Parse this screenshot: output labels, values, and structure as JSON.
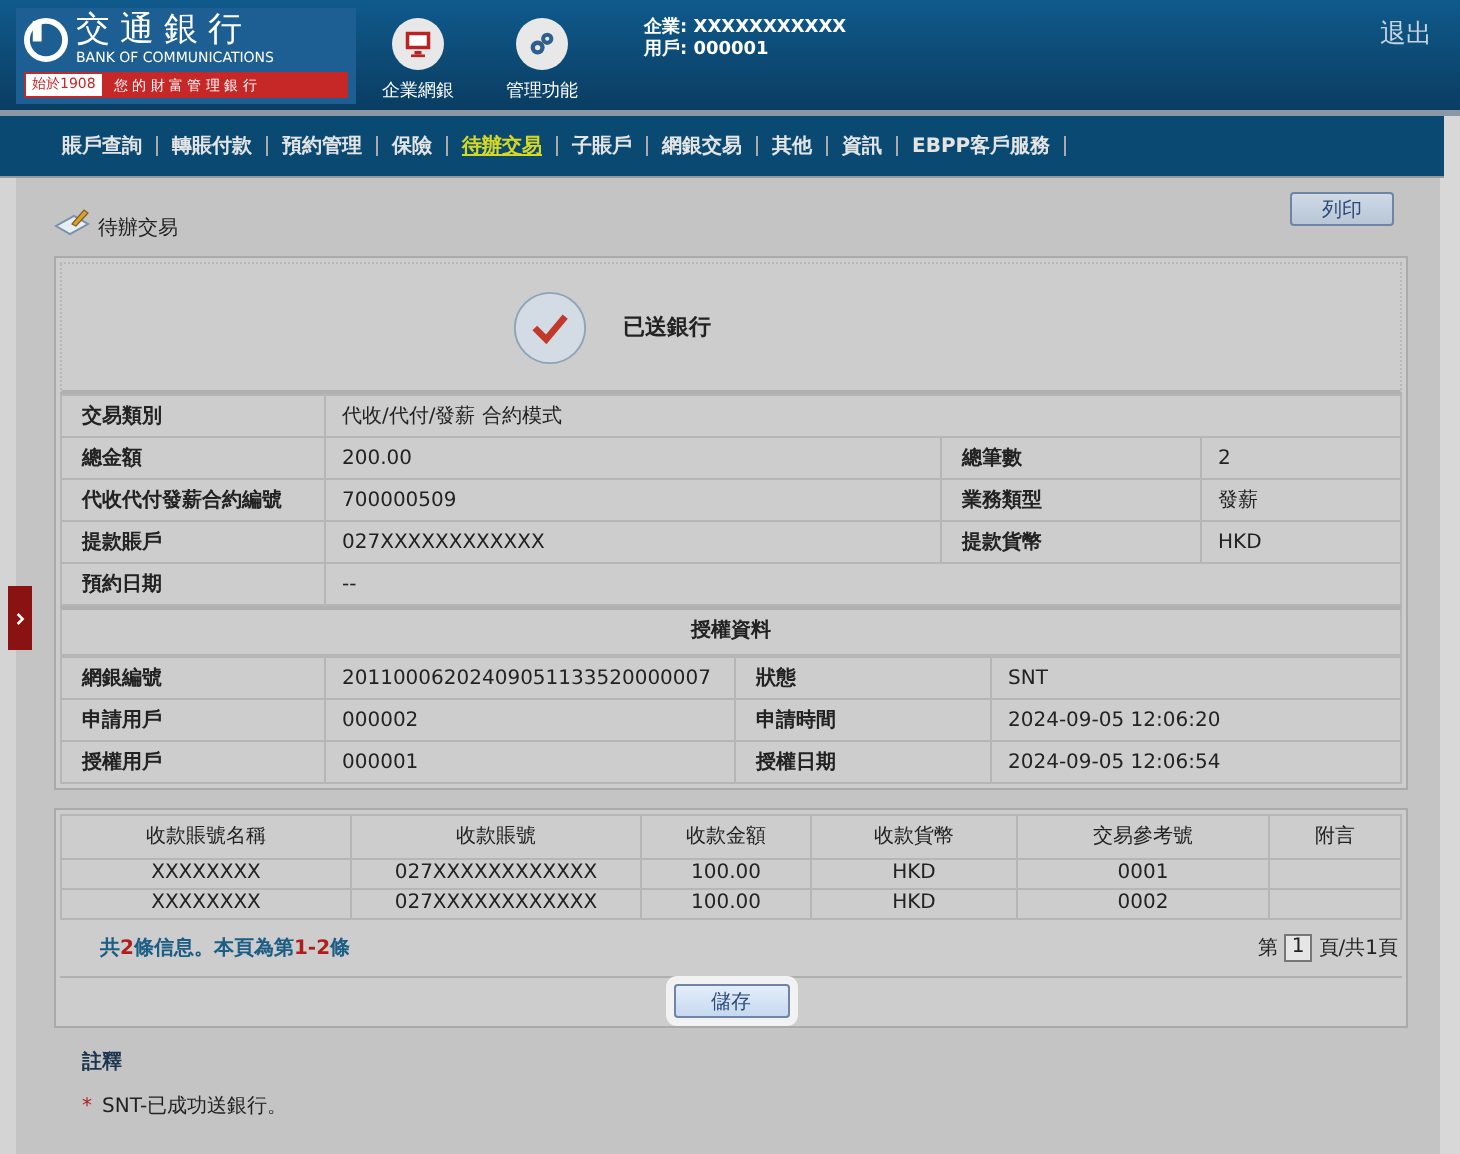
{
  "header": {
    "bank_name": "交通銀行",
    "bank_name_en": "BANK OF COMMUNICATIONS",
    "since": "始於1908",
    "slogan": "您 的 財 富 管 理 銀 行",
    "tools": [
      {
        "label": "企業網銀",
        "kind": "monitor"
      },
      {
        "label": "管理功能",
        "kind": "gears"
      }
    ],
    "company_label": "企業:",
    "company": "XXXXXXXXXXX",
    "user_label": "用戶:",
    "user": "000001",
    "logout": "退出"
  },
  "nav": [
    {
      "label": "賬戶查詢",
      "selected": false
    },
    {
      "label": "轉賬付款",
      "selected": false
    },
    {
      "label": "預約管理",
      "selected": false
    },
    {
      "label": "保險",
      "selected": false
    },
    {
      "label": "待辦交易",
      "selected": true
    },
    {
      "label": "子賬戶",
      "selected": false
    },
    {
      "label": "網銀交易",
      "selected": false
    },
    {
      "label": "其他",
      "selected": false
    },
    {
      "label": "資訊",
      "selected": false
    },
    {
      "label": "EBPP客戶服務",
      "selected": false
    }
  ],
  "page_title": "待辦交易",
  "print_button": "列印",
  "status": "已送銀行",
  "details": [
    {
      "label": "交易類別",
      "value": "代收/代付/發薪 合約模式"
    },
    {
      "label": "總金額",
      "value": "200.00",
      "label2": "總筆數",
      "value2": "2"
    },
    {
      "label": "代收代付發薪合約編號",
      "value": "700000509",
      "label2": "業務類型",
      "value2": "發薪"
    },
    {
      "label": "提款賬戶",
      "value": "027XXXXXXXXXXXX",
      "label2": "提款貨幣",
      "value2": "HKD"
    },
    {
      "label": "預約日期",
      "value": "--"
    }
  ],
  "auth": {
    "title": "授權資料",
    "rows": [
      {
        "label": "網銀編號",
        "value": "20110006202409051133520000007",
        "label2": "狀態",
        "value2": "SNT"
      },
      {
        "label": "申請用戶",
        "value": "000002",
        "label2": "申請時間",
        "value2": "2024-09-05 12:06:20"
      },
      {
        "label": "授權用戶",
        "value": "000001",
        "label2": "授權日期",
        "value2": "2024-09-05 12:06:54"
      }
    ]
  },
  "payees": {
    "columns": [
      "收款賬號名稱",
      "收款賬號",
      "收款金額",
      "收款貨幣",
      "交易參考號",
      "附言"
    ],
    "rows": [
      [
        "XXXXXXXX",
        "027XXXXXXXXXXXX",
        "100.00",
        "HKD",
        "0001",
        ""
      ],
      [
        "XXXXXXXX",
        "027XXXXXXXXXXXX",
        "100.00",
        "HKD",
        "0002",
        ""
      ]
    ],
    "summary": [
      {
        "text": "共",
        "kind": "plain"
      },
      {
        "text": "2",
        "kind": "number"
      },
      {
        "text": "條信息。本頁為第",
        "kind": "plain"
      },
      {
        "text": "1-2",
        "kind": "number"
      },
      {
        "text": "條",
        "kind": "plain"
      }
    ],
    "pager": {
      "before": "第",
      "page": "1",
      "after": "頁/共1頁"
    }
  },
  "save_button": "儲存",
  "notes": {
    "title": "註釋",
    "items": [
      {
        "bullet": "*",
        "text": "SNT-已成功送銀行。"
      }
    ]
  }
}
